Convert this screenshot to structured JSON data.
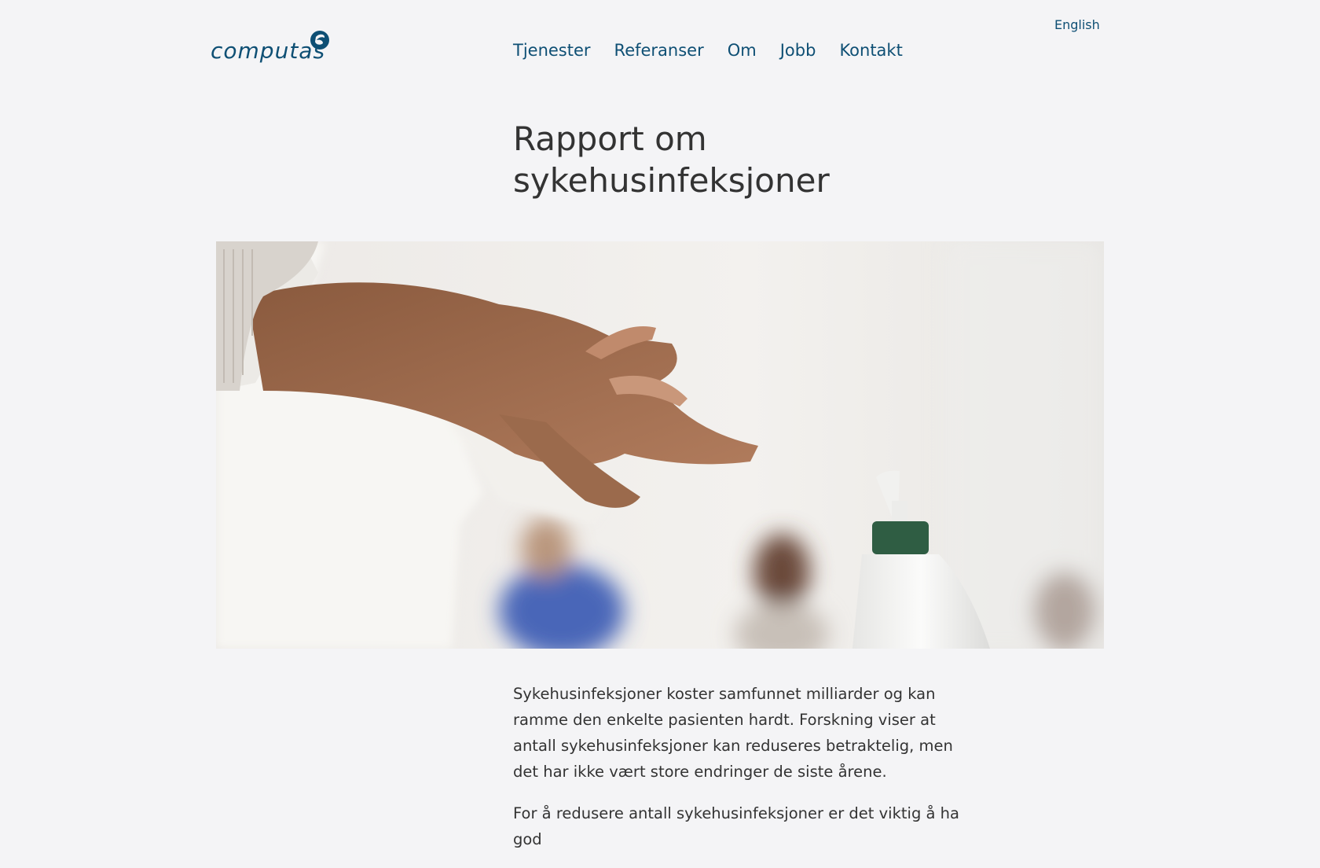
{
  "brand": {
    "logo_text": "computas",
    "logo_color": "#0e4f74"
  },
  "header": {
    "language_link": "English",
    "nav": [
      {
        "label": "Tjenester"
      },
      {
        "label": "Referanser"
      },
      {
        "label": "Om"
      },
      {
        "label": "Jobb"
      },
      {
        "label": "Kontakt"
      }
    ]
  },
  "article": {
    "title": "Rapport om sykehusinfeksjoner",
    "hero_image": "photo-handwashing-with-hand-sanitizer-pump",
    "paragraphs": [
      "Sykehusinfeksjoner koster samfunnet milliarder og kan ramme den enkelte pasienten hardt. Forskning viser at antall sykehusinfeksjoner kan reduseres betraktelig, men det har ikke vært store endringer de siste årene.",
      "For å redusere antall sykehusinfeksjoner er det viktig å ha god"
    ]
  },
  "colors": {
    "background": "#f4f4f6",
    "link": "#0e4f74",
    "text": "#333333"
  }
}
